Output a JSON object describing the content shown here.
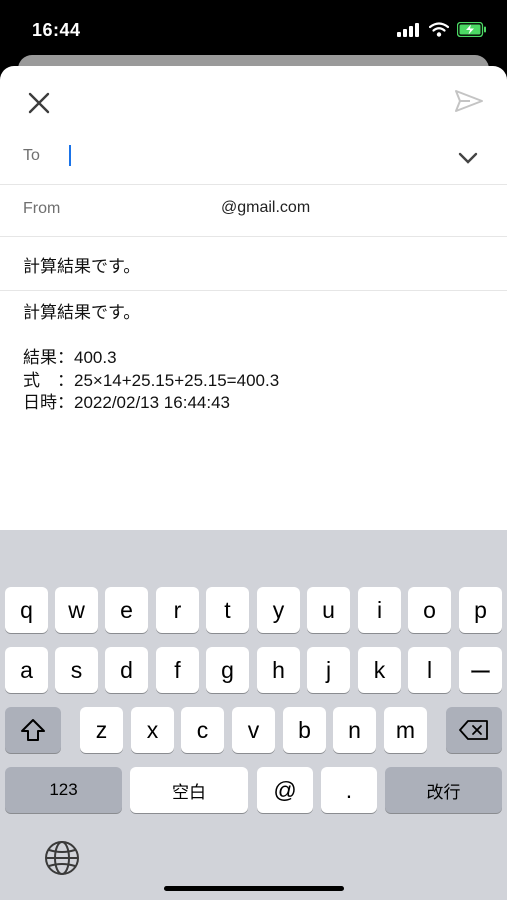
{
  "status_bar": {
    "time": "16:44"
  },
  "compose": {
    "to_label": "To",
    "to_value": "",
    "from_label": "From",
    "from_value": "@gmail.com",
    "subject": "計算結果です。",
    "body_lines": [
      "計算結果です。",
      "",
      "結果：400.3",
      "式　：25×14+25.15+25.15=400.3",
      "日時：2022/02/13 16:44:43"
    ]
  },
  "keyboard": {
    "row1": [
      "q",
      "w",
      "e",
      "r",
      "t",
      "y",
      "u",
      "i",
      "o",
      "p"
    ],
    "row2": [
      "a",
      "s",
      "d",
      "f",
      "g",
      "h",
      "j",
      "k",
      "l",
      "ー"
    ],
    "row3": [
      "z",
      "x",
      "c",
      "v",
      "b",
      "n",
      "m"
    ],
    "numbers_key": "123",
    "space_key": "空白",
    "at_key": "@",
    "period_key": ".",
    "return_key": "改行"
  }
}
